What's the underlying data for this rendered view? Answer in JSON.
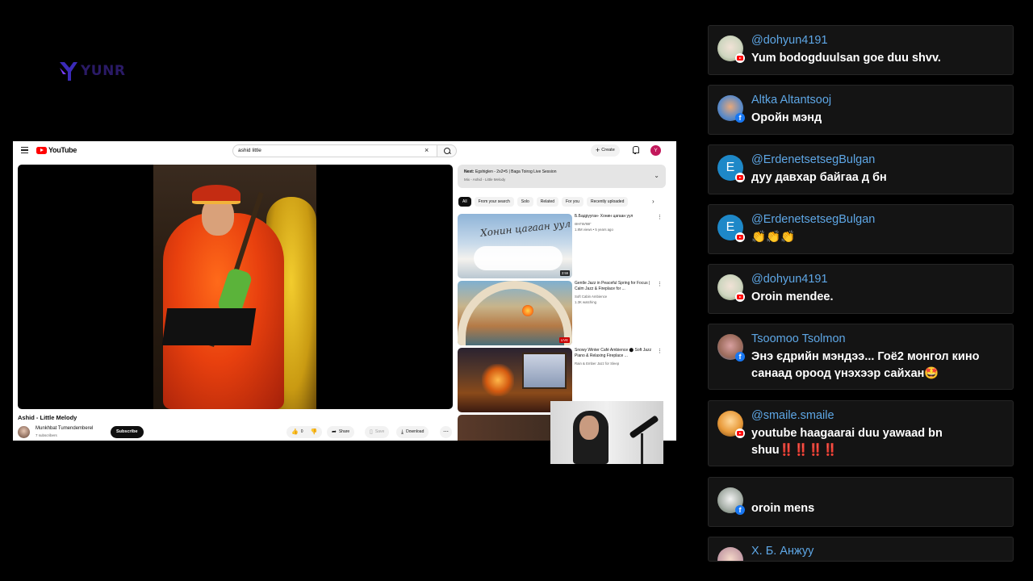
{
  "stream": {
    "logo_text": "YUNR",
    "brand_color": "#3b2ab8"
  },
  "youtube": {
    "logo_label": "YouTube",
    "search_value": "ashid little",
    "clear_icon": "×",
    "create_label": "Create",
    "avatar_letter": "Y",
    "video": {
      "title": "Ashid - Little Melody",
      "channel_name": "Munkhbat Tumendemberel",
      "subscribers": "7 subscribers",
      "subscribe_label": "Subscribe",
      "like_count": "0",
      "share_label": "Share",
      "save_label": "Save",
      "download_label": "Download"
    },
    "up_next": {
      "prefix": "Next:",
      "title": "Egshiglen - 2x2=5 | Baga Toirog Live Session",
      "mix": "Mix - Ashid - Little Melody"
    },
    "chips": [
      "All",
      "From your search",
      "Solo",
      "Related",
      "For you",
      "Recently uploaded"
    ],
    "recommendations": [
      {
        "title": "Б.Бадрууган- Хонин цагаан уул",
        "channel": "ӨНГӨЛӨГ",
        "stats": "1.8M views • 5 years ago",
        "badge": "3:59",
        "thumb_text": "Хонин цагаан уул"
      },
      {
        "title": "Gentle Jazz in Peaceful Spring for Focus | Calm Jazz & Fireplace for ...",
        "channel": "Soft Cabin Ambience",
        "stats": "1.3K watching",
        "badge": "LIVE"
      },
      {
        "title": "Snowy Winter Café Ambience ⬤ Soft Jazz Piano & Relaxing Fireplace ...",
        "channel": "Rain & Ember Jazz for Sleep",
        "stats": ""
      }
    ]
  },
  "chat": {
    "messages": [
      {
        "name": "@dohyun4191",
        "text": "Yum bodogduulsan goe duu shvv.",
        "platform": "youtube"
      },
      {
        "name": "Altka Altantsooj",
        "text": "Оройн мэнд",
        "platform": "facebook"
      },
      {
        "name": "@ErdenetsetsegBulgan",
        "text": "дуу давхар байгаа д бн",
        "platform": "youtube",
        "avatar_letter": "E"
      },
      {
        "name": "@ErdenetsetsegBulgan",
        "text": "👏👏👏",
        "platform": "youtube",
        "avatar_letter": "E"
      },
      {
        "name": "@dohyun4191",
        "text": "Oroin mendee.",
        "platform": "youtube"
      },
      {
        "name": "Tsoomoo Tsolmon",
        "text": "Энэ єдрийн мэндээ... Гоё2 монгол кино санаад ороод үнэхээр сайхан🤩",
        "platform": "facebook"
      },
      {
        "name": "@smaile.smaile",
        "text": "youtube haagaarai duu yawaad bn shuu‼️‼️‼️‼️",
        "platform": "youtube"
      },
      {
        "name": "",
        "text": "oroin mens",
        "platform": "facebook"
      },
      {
        "name": "Х. Б. Анжуу",
        "text": "",
        "platform": "facebook"
      }
    ]
  }
}
